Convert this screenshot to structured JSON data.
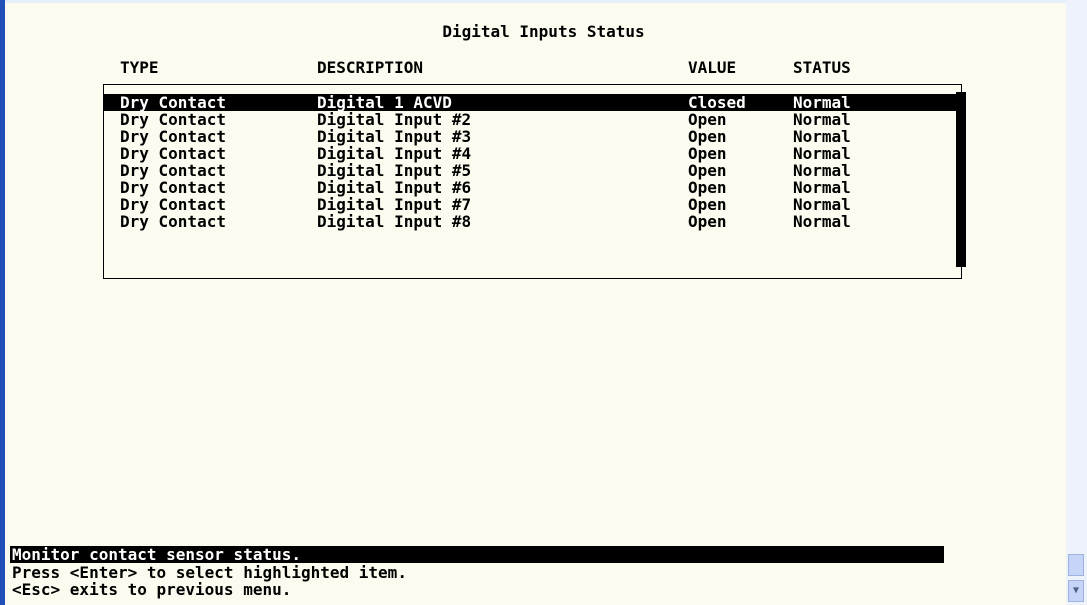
{
  "screen": {
    "title": "Digital Inputs Status",
    "columns": [
      "TYPE",
      "DESCRIPTION",
      "VALUE",
      "STATUS"
    ],
    "rows": [
      {
        "type": "Dry Contact",
        "description": "Digital 1 ACVD",
        "value": "Closed",
        "status": "Normal",
        "selected": true
      },
      {
        "type": "Dry Contact",
        "description": "Digital Input #2",
        "value": "Open",
        "status": "Normal"
      },
      {
        "type": "Dry Contact",
        "description": "Digital Input #3",
        "value": "Open",
        "status": "Normal"
      },
      {
        "type": "Dry Contact",
        "description": "Digital Input #4",
        "value": "Open",
        "status": "Normal"
      },
      {
        "type": "Dry Contact",
        "description": "Digital Input #5",
        "value": "Open",
        "status": "Normal"
      },
      {
        "type": "Dry Contact",
        "description": "Digital Input #6",
        "value": "Open",
        "status": "Normal"
      },
      {
        "type": "Dry Contact",
        "description": "Digital Input #7",
        "value": "Open",
        "status": "Normal"
      },
      {
        "type": "Dry Contact",
        "description": "Digital Input #8",
        "value": "Open",
        "status": "Normal"
      }
    ]
  },
  "footer": {
    "status_line": "Monitor contact sensor status.",
    "help_enter": "Press <Enter> to select highlighted item.",
    "help_esc": "<Esc> exits to previous menu."
  },
  "scrollbar": {
    "down_icon": "chevron-down-icon"
  },
  "colors": {
    "background": "#fbfbef",
    "highlight": "#000000",
    "window_edge": "#1f4fb7"
  }
}
